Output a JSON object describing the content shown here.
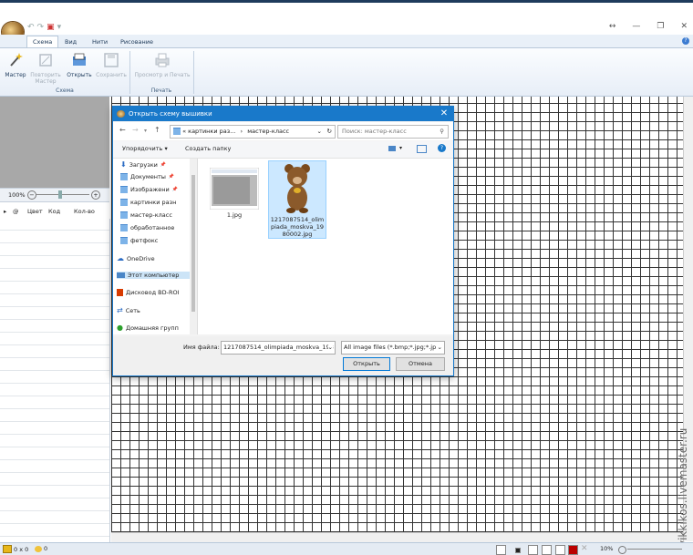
{
  "window": {
    "quick_access": [
      "↶",
      "↷",
      "▣",
      "▾"
    ],
    "controls": [
      "↔",
      "—",
      "❐",
      "✕"
    ]
  },
  "ribbon": {
    "tabs": [
      "Схема",
      "Вид",
      "Нити",
      "Рисование"
    ],
    "active_tab": "Схема",
    "buttons": {
      "wizard": "Мастер",
      "repeat_wizard": "Повторить Мастер",
      "open": "Открыть",
      "save": "Сохранить",
      "print_preview": "Просмотр и Печать"
    },
    "groups": {
      "schema": "Схема",
      "print": "Печать"
    }
  },
  "left_panel": {
    "zoom": "100%",
    "columns": [
      "@",
      "Цвет",
      "Код",
      "Кол-во"
    ]
  },
  "status": {
    "size": "0 x 0",
    "count": "0",
    "zoom": "10%"
  },
  "watermark": "vikkikos.livemaster.ru",
  "dialog": {
    "title": "Открыть схему вышивки",
    "breadcrumb": [
      "«",
      "картинки раз...",
      "›",
      "мастер-класс"
    ],
    "search_placeholder": "Поиск: мастер-класс",
    "organize": "Упорядочить ▾",
    "new_folder": "Создать папку",
    "nav": [
      {
        "label": "Загрузки",
        "pinned": true
      },
      {
        "label": "Документы",
        "pinned": true
      },
      {
        "label": "Изображени",
        "pinned": true
      },
      {
        "label": "картинки разн",
        "pinned": false
      },
      {
        "label": "мастер-класс",
        "pinned": false
      },
      {
        "label": "обработанное",
        "pinned": false
      },
      {
        "label": "фетфокс",
        "pinned": false
      },
      {
        "label": "OneDrive",
        "pinned": false
      },
      {
        "label": "Этот компьютер",
        "pinned": false
      },
      {
        "label": "Дисковод BD-ROI",
        "pinned": false
      },
      {
        "label": "Сеть",
        "pinned": false
      },
      {
        "label": "Домашняя групп",
        "pinned": false
      }
    ],
    "files": [
      {
        "name": "1.jpg"
      },
      {
        "name": "1217087514_olimpiada_moskva_1980002.jpg",
        "lines": [
          "1217087514_olim",
          "piada_moskva_19",
          "80002.jpg"
        ]
      }
    ],
    "filename_label": "Имя файла:",
    "filename_value": "1217087514_olimpiada_moskva_198",
    "filter": "All image files (*.bmp;*.jpg;*.jp",
    "open_button": "Открыть",
    "cancel_button": "Отмена"
  },
  "colors": {
    "dialog_title": "#1979ca",
    "ribbon_bg": "#e7eef7",
    "grid_line": "#333333"
  }
}
